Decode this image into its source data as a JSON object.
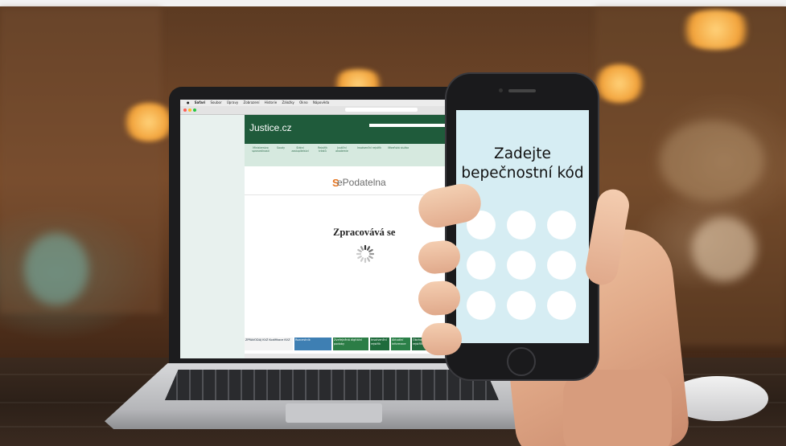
{
  "laptop": {
    "menubar": [
      "Safari",
      "Soubor",
      "Úpravy",
      "Zobrazení",
      "Historie",
      "Záložky",
      "Okno",
      "Nápověda"
    ],
    "site_logo": "Justice.cz",
    "nav_items": [
      "Ministerstvo spravedlnosti",
      "Soudy",
      "Státní zastupitelství",
      "Rejstřík trestů",
      "Justiční akademie",
      "Insolvenční rejstřík",
      "Vězeňská služba"
    ],
    "epodatelna_logo": "ePodatelna",
    "status_text": "Zpracovává se",
    "ads": [
      "ZPRAVODAJ KVZ Kodifikace KVZ",
      "Rozcestník",
      "Zveřejněná digitální podoby",
      "Insolvenční rejstřík",
      "Aktuální informace",
      "Obchodní rejstřík"
    ]
  },
  "phone": {
    "prompt_line1": "Zadejte",
    "prompt_line2": "bepečnostní kód",
    "pin_pad_count": 9
  },
  "colors": {
    "justice_green": "#1f5b3b",
    "phone_screen": "#d6edf3",
    "epodatelna_orange": "#e5731e"
  }
}
